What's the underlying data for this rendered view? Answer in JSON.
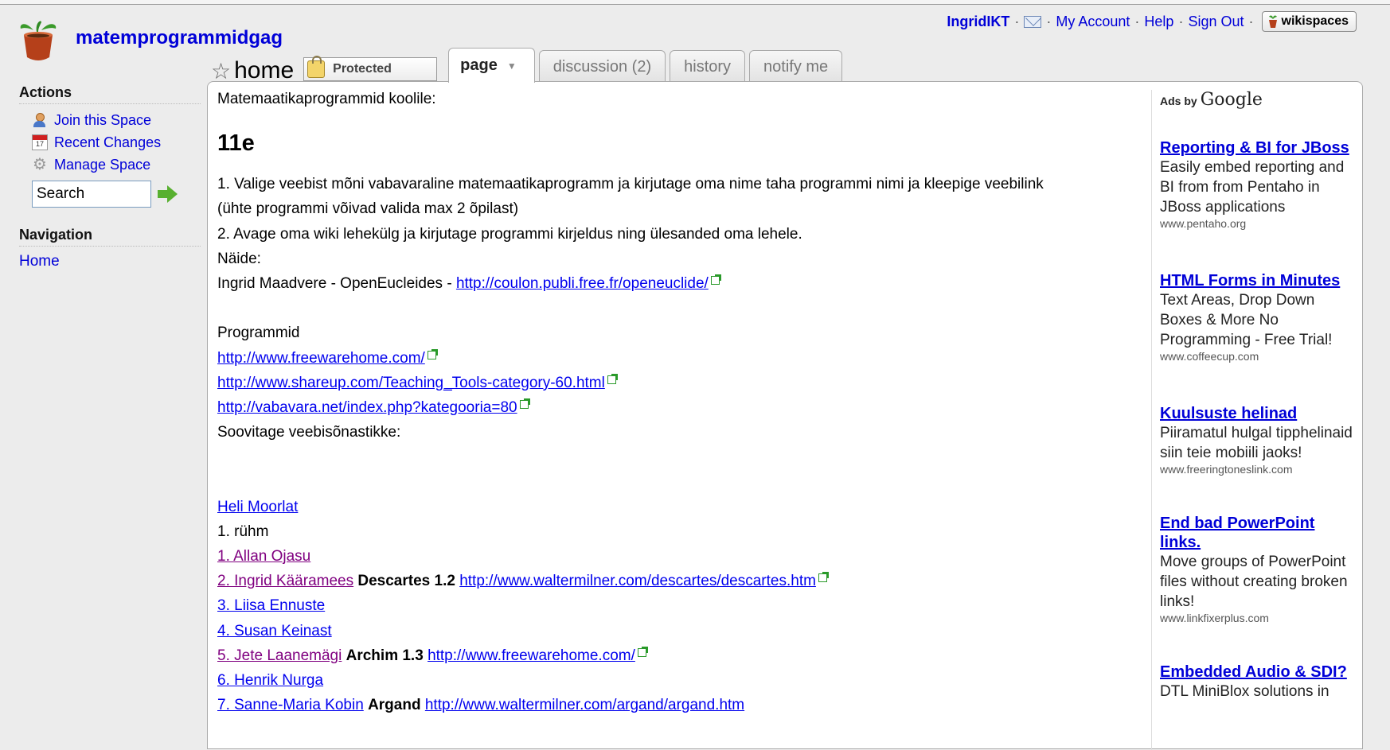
{
  "site": {
    "name": "matemprogrammidgag"
  },
  "userbar": {
    "username": "IngridIKT",
    "sep": "·",
    "my_account": "My Account",
    "help": "Help",
    "sign_out": "Sign Out",
    "brand": "wikispaces"
  },
  "page": {
    "title": "home",
    "protected": "Protected",
    "tabs": {
      "page": "page",
      "discussion": "discussion (2)",
      "history": "history",
      "notify": "notify me"
    }
  },
  "sidebar": {
    "actions_heading": "Actions",
    "actions": {
      "join": "Join this Space",
      "recent": "Recent Changes",
      "manage": "Manage Space"
    },
    "search_value": "Search",
    "navigation_heading": "Navigation",
    "home": "Home"
  },
  "main": {
    "intro": "Matemaatikaprogrammid koolile:",
    "heading": "11e",
    "p1a": "1. Valige veebist mõni vabavaraline matemaatikaprogramm ja kirjutage oma nime taha programmi nimi ja kleepige veebilink",
    "p1b": "(ühte programmi võivad valida max 2 õpilast)",
    "p2": "2. Avage oma wiki lehekülg ja kirjutage programmi kirjeldus ning ülesanded oma lehele.",
    "example_label": "Näide:",
    "example_text": "Ingrid Maadvere - OpenEucleides - ",
    "example_link": "http://coulon.publi.free.fr/openeuclide/",
    "programs_label": "Programmid",
    "links": [
      "http://www.freewarehome.com/",
      "http://www.shareup.com/Teaching_Tools-category-60.html",
      "http://vabavara.net/index.php?kategooria=80"
    ],
    "dictionary_text": "Soovitage veebisõnastikke:",
    "teacher_link": "Heli Moorlat",
    "group_label": "1. rühm",
    "students": [
      {
        "name": "1. Allan Ojasu",
        "program": "",
        "url": ""
      },
      {
        "name": "2. Ingrid Kääramees",
        "program": "Descartes 1.2",
        "url": "http://www.waltermilner.com/descartes/descartes.htm"
      },
      {
        "name": "3. Liisa Ennuste",
        "program": "",
        "url": ""
      },
      {
        "name": "4. Susan Keinast",
        "program": "",
        "url": ""
      },
      {
        "name": "5. Jete Laanemägi",
        "program": "Archim 1.3",
        "url": "http://www.freewarehome.com/"
      },
      {
        "name": "6. Henrik Nurga",
        "program": "",
        "url": ""
      },
      {
        "name": "7. Sanne-Maria Kobin",
        "program": "Argand",
        "url": "http://www.waltermilner.com/argand/argand.htm"
      }
    ]
  },
  "ads": {
    "ads_by": "Ads by",
    "google": "Google",
    "items": [
      {
        "title": "Reporting & BI for JBoss",
        "desc": "Easily embed reporting and BI from from Pentaho in JBoss applications",
        "url": "www.pentaho.org"
      },
      {
        "title": "HTML Forms in Minutes",
        "desc": "Text Areas, Drop Down Boxes & More No Programming - Free Trial!",
        "url": "www.coffeecup.com"
      },
      {
        "title": "Kuulsuste helinad",
        "desc": "Piiramatul hulgal tipphelinaid siin teie mobiili jaoks!",
        "url": "www.freeringtoneslink.com"
      },
      {
        "title": "End bad PowerPoint links.",
        "desc": "Move groups of PowerPoint files without creating broken links!",
        "url": "www.linkfixerplus.com"
      },
      {
        "title": "Embedded Audio & SDI?",
        "desc": "DTL MiniBlox solutions in",
        "url": ""
      }
    ]
  }
}
